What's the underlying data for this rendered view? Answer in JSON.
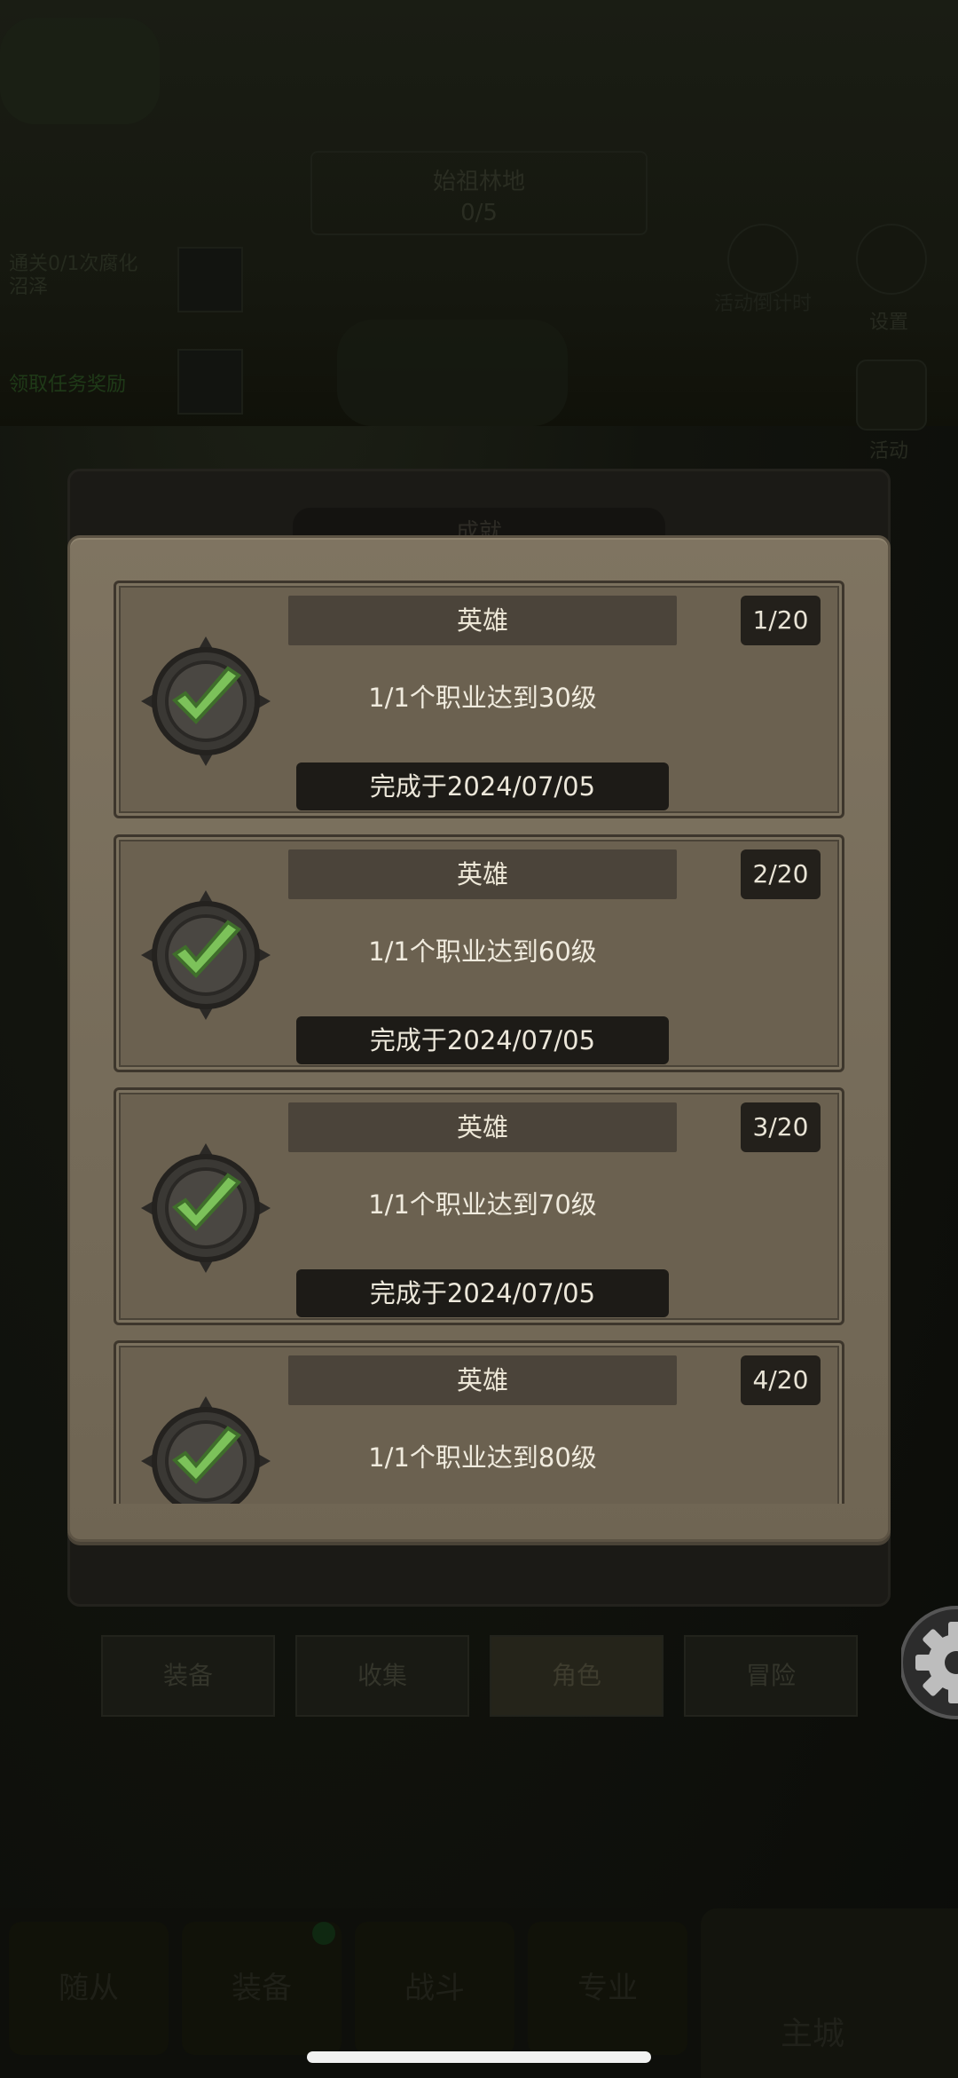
{
  "background": {
    "area_title": "始祖林地",
    "area_progress": "0/5",
    "quest_text": "通关0/1次腐化沼泽",
    "quest_sub": "领取任务奖励",
    "side_labels": [
      "设置",
      "活动"
    ],
    "side_notice": "活动倒计时",
    "back_panel_title": "成就",
    "tabs": [
      {
        "label": "装备",
        "active": false
      },
      {
        "label": "收集",
        "active": false
      },
      {
        "label": "角色",
        "active": true
      },
      {
        "label": "冒险",
        "active": false
      }
    ],
    "nav": [
      "随从",
      "装备",
      "战斗",
      "专业"
    ],
    "nav_main": "主城"
  },
  "achievements": [
    {
      "title": "英雄",
      "count": "1/20",
      "desc": "1/1个职业达到30级",
      "date": "完成于2024/07/05"
    },
    {
      "title": "英雄",
      "count": "2/20",
      "desc": "1/1个职业达到60级",
      "date": "完成于2024/07/05"
    },
    {
      "title": "英雄",
      "count": "3/20",
      "desc": "1/1个职业达到70级",
      "date": "完成于2024/07/05"
    },
    {
      "title": "英雄",
      "count": "4/20",
      "desc": "1/1个职业达到80级",
      "date": ""
    }
  ],
  "colors": {
    "check": "#7cc25a",
    "badge_ring": "#3a3834",
    "panel": "#7a6f5c"
  }
}
